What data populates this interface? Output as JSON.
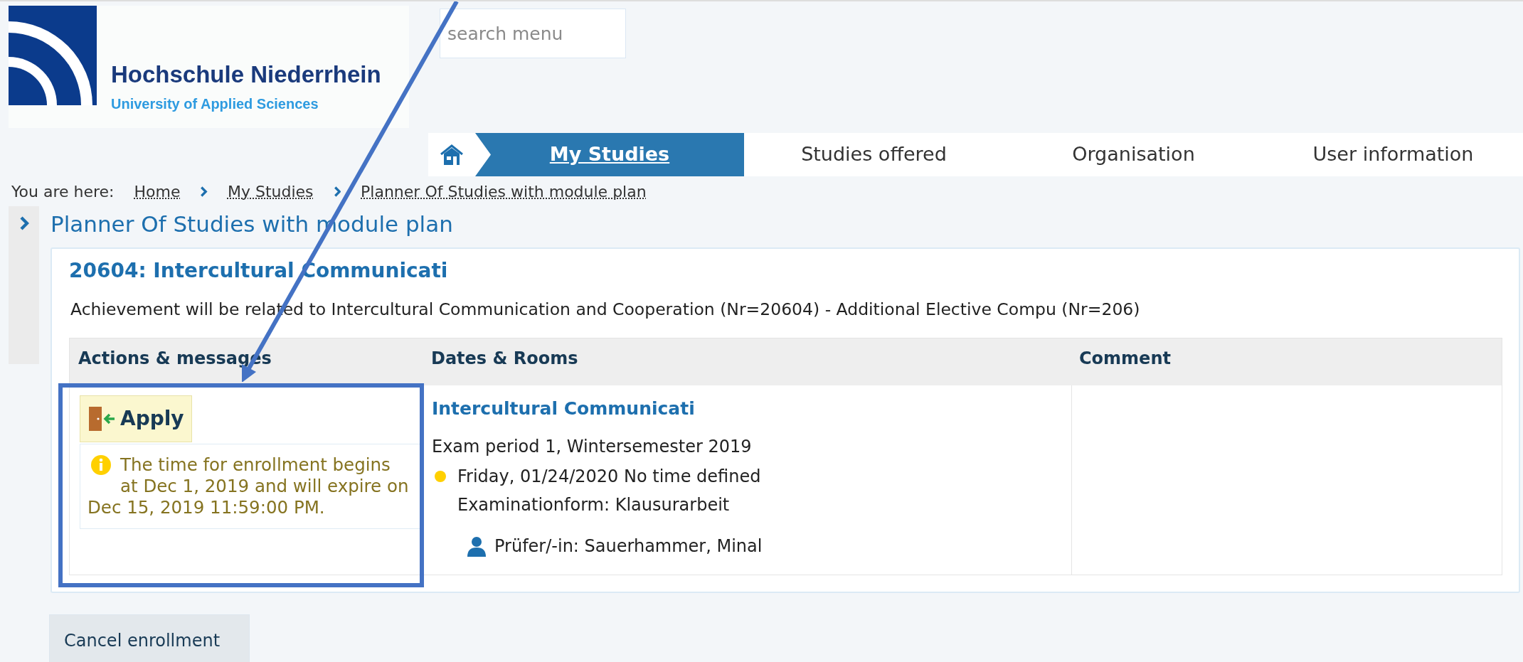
{
  "logo": {
    "name": "Hochschule Niederrhein",
    "subtitle": "University of Applied Sciences"
  },
  "search": {
    "placeholder": "search menu"
  },
  "nav": [
    {
      "label": "My Studies",
      "selected": true
    },
    {
      "label": "Studies offered",
      "selected": false
    },
    {
      "label": "Organisation",
      "selected": false
    },
    {
      "label": "User information",
      "selected": false
    }
  ],
  "breadcrumb": {
    "prefix": "You are here:",
    "items": [
      "Home",
      "My Studies",
      "Planner Of Studies with module plan"
    ]
  },
  "page_title": "Planner Of Studies with module plan",
  "module": {
    "title": "20604: Intercultural Communicati",
    "description": "Achievement will be related to Intercultural Communication and Cooperation (Nr=20604) - Additional Elective Compu (Nr=206)",
    "table": {
      "columns": [
        "Actions & messages",
        "Dates & Rooms",
        "Comment"
      ],
      "rows": [
        {
          "action": "Apply",
          "message": "The time for enrollment begins at Dec 1, 2019 and will expire on Dec 15, 2019 11:59:00 PM.",
          "dates": {
            "title": "Intercultural Communicati",
            "period": "Exam period 1, Wintersemester 2019",
            "date": "Friday, 01/24/2020 No time defined",
            "form": "Examinationform: Klausurarbeit",
            "examiner": "Prüfer/-in: Sauerhammer, Minal"
          }
        }
      ]
    }
  },
  "cancel_button": "Cancel enrollment"
}
